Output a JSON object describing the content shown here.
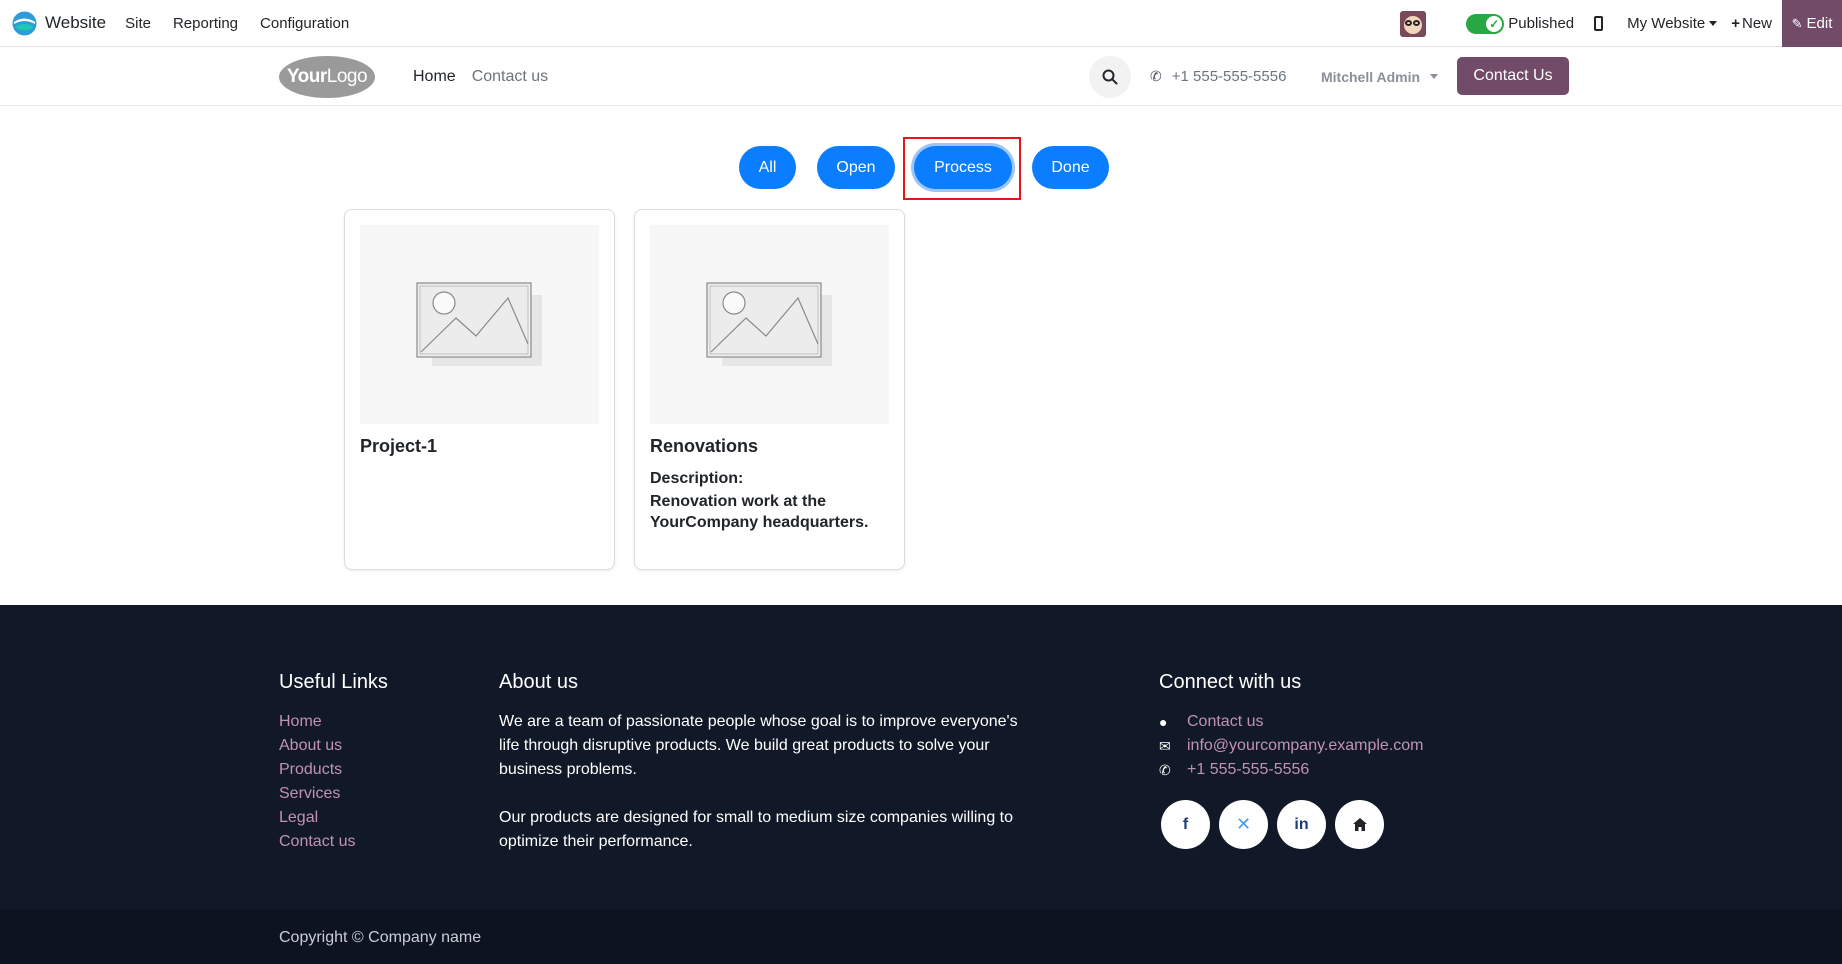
{
  "topbar": {
    "app_name": "Website",
    "menu": [
      "Site",
      "Reporting",
      "Configuration"
    ],
    "published_label": "Published",
    "my_website_label": "My Website",
    "new_label": "New",
    "edit_label": "Edit"
  },
  "header": {
    "logo_text_bold": "Your",
    "logo_text_light": "Logo",
    "nav": [
      "Home",
      "Contact us"
    ],
    "phone": "+1 555-555-5556",
    "user": "Mitchell Admin",
    "cta": "Contact Us"
  },
  "filters": {
    "items": [
      "All",
      "Open",
      "Process",
      "Done"
    ],
    "selected": "Process"
  },
  "projects": [
    {
      "title": "Project-1",
      "desc_label": "",
      "description": ""
    },
    {
      "title": "Renovations",
      "desc_label": "Description:",
      "description": "Renovation work at the YourCompany headquarters."
    }
  ],
  "footer": {
    "useful_links_title": "Useful Links",
    "useful_links": [
      "Home",
      "About us",
      "Products",
      "Services",
      "Legal",
      "Contact us"
    ],
    "about_title": "About us",
    "about_p1": "We are a team of passionate people whose goal is to improve everyone's life through disruptive products. We build great products to solve your business problems.",
    "about_p2": "Our products are designed for small to medium size companies willing to optimize their performance.",
    "connect_title": "Connect with us",
    "contact_link": "Contact us",
    "email": "info@yourcompany.example.com",
    "phone": "+1 555-555-5556",
    "socials": [
      "facebook-icon",
      "x-twitter-icon",
      "linkedin-icon",
      "home-icon"
    ],
    "copyright": "Copyright © Company name"
  },
  "colors": {
    "brand": "#714b67",
    "filter_pill": "#0b7dff",
    "highlight": "#e8141b",
    "footer_bg": "#111827",
    "footer_link": "#c292b4",
    "toggle_on": "#28a745"
  }
}
